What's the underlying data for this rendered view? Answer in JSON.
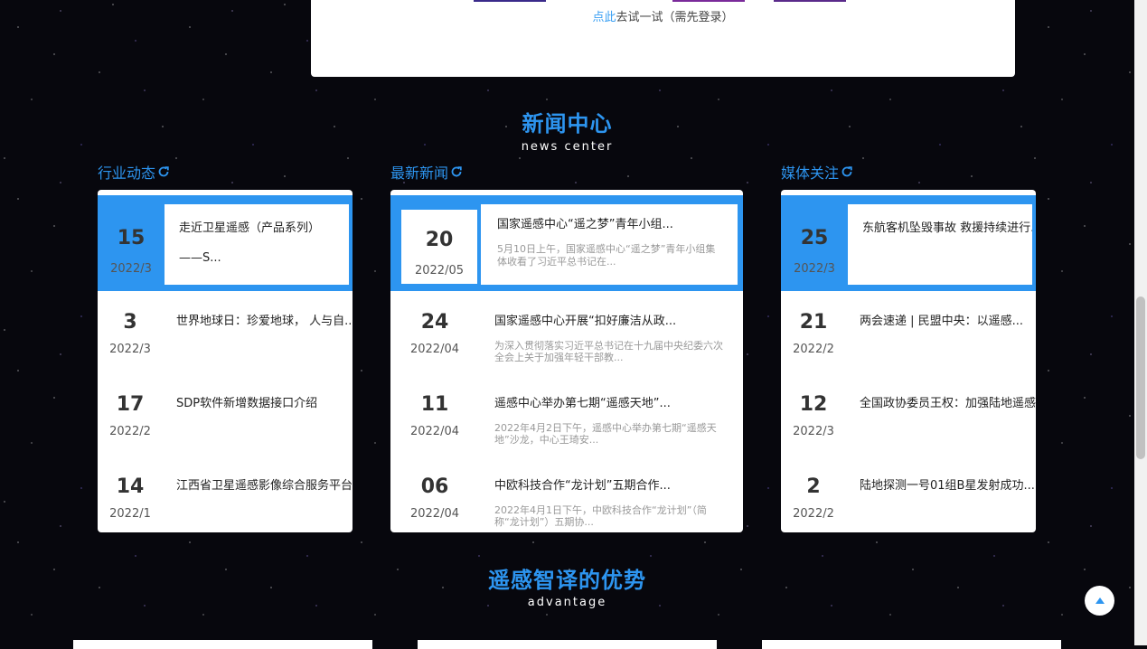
{
  "top_panel": {
    "link_text": "点此",
    "hint_text": "去试一试（需先登录）"
  },
  "news_section": {
    "title": "新闻中心",
    "subtitle": "news center"
  },
  "columns": [
    {
      "title": "行业动态",
      "featured": {
        "day": "15",
        "ym": "2022/3",
        "title": "走近卫星遥感（产品系列）——S...",
        "desc": ""
      },
      "items": [
        {
          "day": "3",
          "ym": "2022/3",
          "title": "世界地球日：珍爱地球， 人与自...",
          "desc": ""
        },
        {
          "day": "17",
          "ym": "2022/2",
          "title": "SDP软件新增数据接口介绍",
          "desc": ""
        },
        {
          "day": "14",
          "ym": "2022/1",
          "title": "江西省卫星遥感影像综合服务平台",
          "desc": ""
        }
      ]
    },
    {
      "title": "最新新闻",
      "featured": {
        "day": "20",
        "ym": "2022/05",
        "title": "国家遥感中心“遥之梦”青年小组...",
        "desc": "5月10日上午，国家遥感中心“遥之梦”青年小组集体收看了习近平总书记在..."
      },
      "items": [
        {
          "day": "24",
          "ym": "2022/04",
          "title": "国家遥感中心开展“扣好廉洁从政...",
          "desc": "为深入贯彻落实习近平总书记在十九届中央纪委六次全会上关于加强年轻干部教..."
        },
        {
          "day": "11",
          "ym": "2022/04",
          "title": "遥感中心举办第七期“遥感天地”...",
          "desc": "2022年4月2日下午，遥感中心举办第七期“遥感天地”沙龙，中心王琦安..."
        },
        {
          "day": "06",
          "ym": "2022/04",
          "title": "中欧科技合作“龙计划”五期合作...",
          "desc": "2022年4月1日下午，中欧科技合作“龙计划”（简称“龙计划”）五期协..."
        }
      ]
    },
    {
      "title": "媒体关注",
      "featured": {
        "day": "25",
        "ym": "2022/3",
        "title": "东航客机坠毁事故 救援持续进行...",
        "desc": ""
      },
      "items": [
        {
          "day": "21",
          "ym": "2022/2",
          "title": "两会速递 | 民盟中央：以遥感...",
          "desc": ""
        },
        {
          "day": "12",
          "ym": "2022/3",
          "title": "全国政协委员王权：加强陆地遥感",
          "desc": ""
        },
        {
          "day": "2",
          "ym": "2022/2",
          "title": "陆地探测一号01组B星发射成功...",
          "desc": ""
        }
      ]
    }
  ],
  "advantage_section": {
    "title": "遥感智译的优势",
    "subtitle": "advantage"
  },
  "colors": {
    "accent": "#2d95f0",
    "background": "#07070d"
  },
  "icons": {
    "refresh": "refresh-icon",
    "back_to_top": "caret-up-icon"
  }
}
